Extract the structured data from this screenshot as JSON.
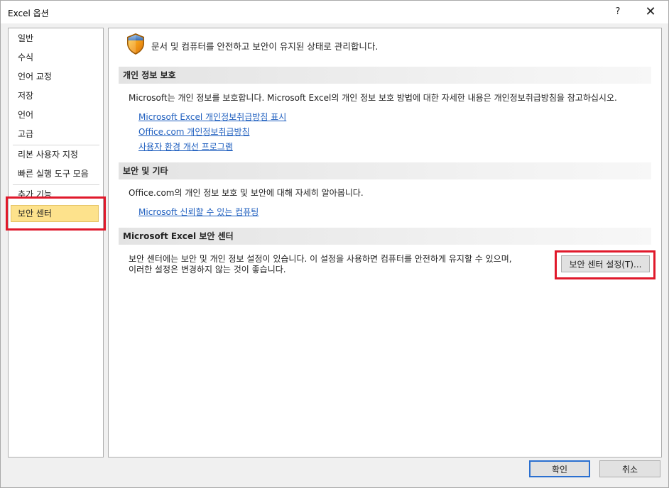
{
  "window": {
    "title": "Excel 옵션",
    "help_glyph": "?",
    "close_glyph": "✕"
  },
  "sidebar": {
    "items": [
      {
        "label": "일반"
      },
      {
        "label": "수식"
      },
      {
        "label": "언어 교정"
      },
      {
        "label": "저장"
      },
      {
        "label": "언어"
      },
      {
        "label": "고급"
      },
      {
        "label": "리본 사용자 지정"
      },
      {
        "label": "빠른 실행 도구 모음"
      },
      {
        "label": "추가 기능"
      },
      {
        "label": "보안 센터",
        "selected": true
      }
    ]
  },
  "header": {
    "icon": "shield-icon",
    "text": "문서 및 컴퓨터를 안전하고 보안이 유지된 상태로 관리합니다."
  },
  "privacy": {
    "title": "개인 정보 보호",
    "description": "Microsoft는 개인 정보를 보호합니다. Microsoft Excel의 개인 정보 보호 방법에 대한 자세한 내용은 개인정보취급방침을 참고하십시오.",
    "links": [
      "Microsoft Excel 개인정보취급방침 표시",
      "Office.com 개인정보취급방침",
      "사용자 환경 개선 프로그램"
    ]
  },
  "security": {
    "title": "보안 및 기타",
    "description": "Office.com의 개인 정보 보호 및 보안에 대해 자세히 알아봅니다.",
    "link": "Microsoft 신뢰할 수 있는 컴퓨팅"
  },
  "trust_center": {
    "title": "Microsoft Excel 보안 센터",
    "description_line1": "보안 센터에는 보안 및 개인 정보 설정이 있습니다. 이 설정을 사용하면 컴퓨터를 안전하게 유지할 수 있으며,",
    "description_line2": "이러한 설정은 변경하지 않는 것이 좋습니다.",
    "settings_button": "보안 센터 설정(T)..."
  },
  "footer": {
    "ok": "확인",
    "cancel": "취소"
  },
  "colors": {
    "highlight_red": "#e0192b",
    "selected_bg": "#fde28c",
    "link": "#1f5fbf",
    "primary_border": "#2a6fd0"
  }
}
